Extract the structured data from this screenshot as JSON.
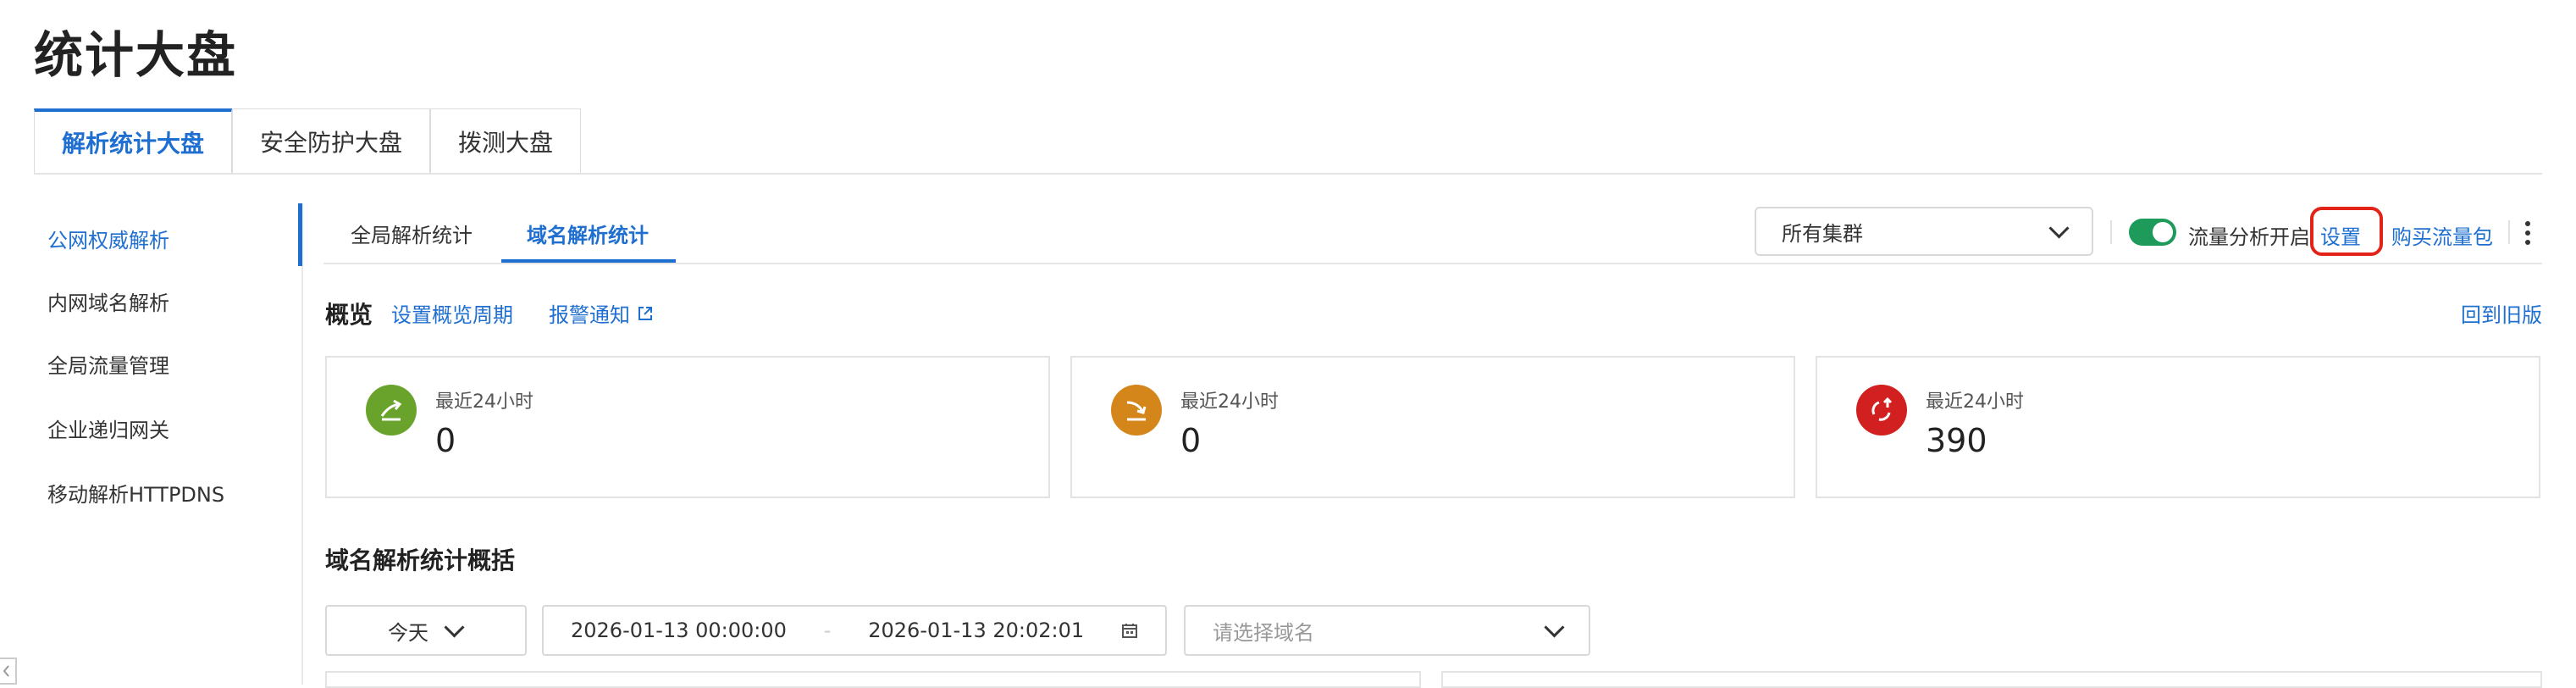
{
  "page": {
    "title": "统计大盘"
  },
  "main_tabs": [
    {
      "label": "解析统计大盘",
      "active": true
    },
    {
      "label": "安全防护大盘",
      "active": false
    },
    {
      "label": "拨测大盘",
      "active": false
    }
  ],
  "sidebar": {
    "items": [
      {
        "label": "公网权威解析",
        "active": true
      },
      {
        "label": "内网域名解析",
        "active": false
      },
      {
        "label": "全局流量管理",
        "active": false
      },
      {
        "label": "企业递归网关",
        "active": false
      },
      {
        "label": "移动解析HTTPDNS",
        "active": false
      }
    ]
  },
  "sub_tabs": [
    {
      "label": "全局解析统计",
      "active": false
    },
    {
      "label": "域名解析统计",
      "active": true
    }
  ],
  "toolbar": {
    "cluster_select": "所有集群",
    "traffic_toggle_label": "流量分析开启",
    "traffic_toggle_on": true,
    "settings_link": "设置",
    "buy_link": "购买流量包",
    "more_icon": "more-vertical-icon"
  },
  "overview": {
    "title": "概览",
    "set_period_link": "设置概览周期",
    "alert_link": "报警通知",
    "back_link": "回到旧版",
    "cards": [
      {
        "icon": "arrow-up-out-icon",
        "icon_color": "#6aa32b",
        "label": "最近24小时",
        "value": "0"
      },
      {
        "icon": "arrow-down-in-icon",
        "icon_color": "#d4861b",
        "label": "最近24小时",
        "value": "0"
      },
      {
        "icon": "refresh-up-icon",
        "icon_color": "#d21f1f",
        "label": "最近24小时",
        "value": "390"
      }
    ]
  },
  "summary": {
    "title": "域名解析统计概括",
    "range_select": "今天",
    "start_time": "2026-01-13 00:00:00",
    "separator": "-",
    "end_time": "2026-01-13 20:02:01",
    "domain_placeholder": "请选择域名"
  },
  "colors": {
    "accent": "#1f6fd1",
    "toggle_on": "#1e9a5a",
    "highlight": "#e2231a"
  }
}
